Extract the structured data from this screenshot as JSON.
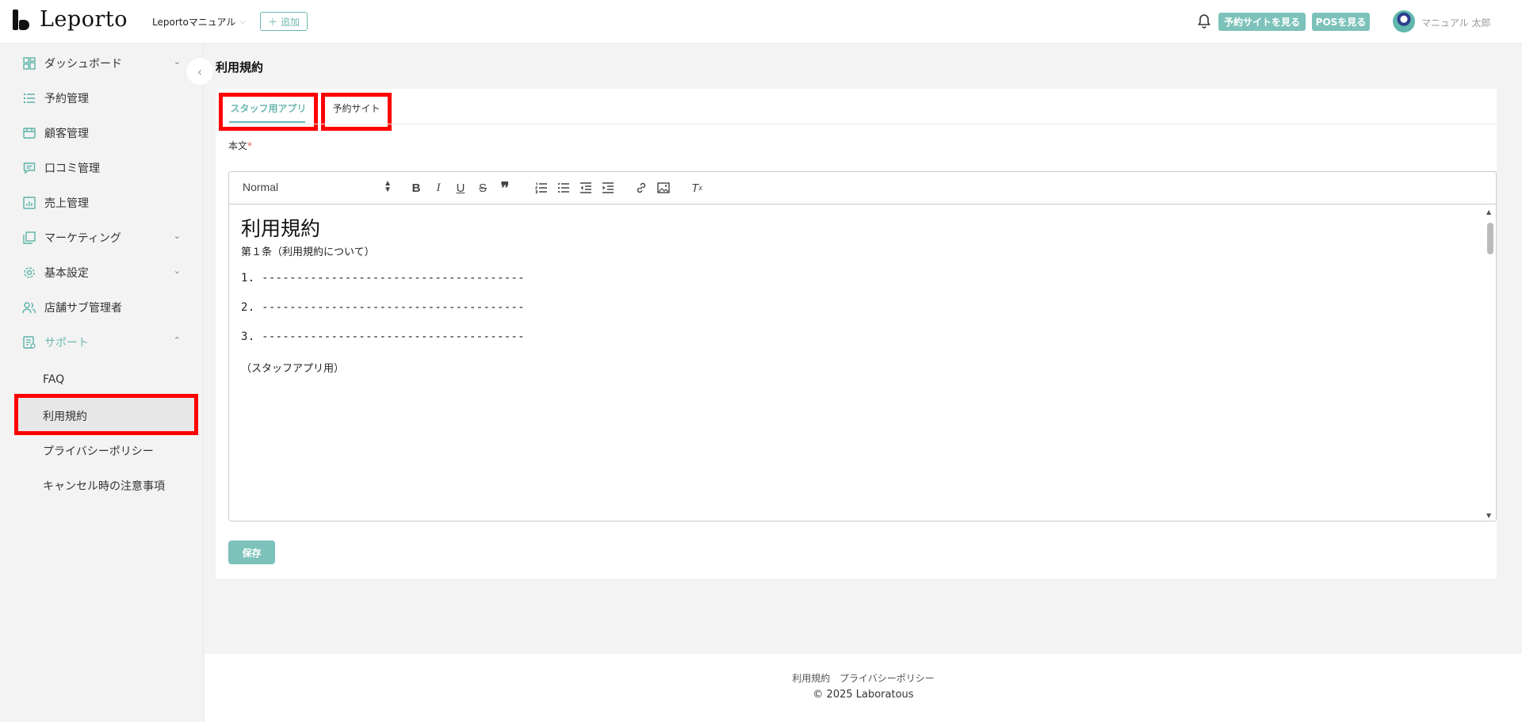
{
  "header": {
    "logo_text": "Leporto",
    "store_name": "Leportoマニュアル",
    "add_label": "追加",
    "view_site_label": "予約サイトを見る",
    "view_pos_label": "POSを見る",
    "user_name": "マニュアル 太郎"
  },
  "sidebar": {
    "items": [
      {
        "label": "ダッシュボード",
        "icon": "dashboard-icon",
        "caret": "⌄"
      },
      {
        "label": "予約管理",
        "icon": "list-icon"
      },
      {
        "label": "顧客管理",
        "icon": "customer-icon"
      },
      {
        "label": "口コミ管理",
        "icon": "review-icon"
      },
      {
        "label": "売上管理",
        "icon": "sales-icon"
      },
      {
        "label": "マーケティング",
        "icon": "marketing-icon",
        "caret": "⌄"
      },
      {
        "label": "基本設定",
        "icon": "gear-icon",
        "caret": "⌄"
      },
      {
        "label": "店舗サブ管理者",
        "icon": "users-icon"
      },
      {
        "label": "サポート",
        "icon": "support-icon",
        "caret": "⌃"
      }
    ],
    "sub_items": [
      "FAQ",
      "利用規約",
      "プライバシーポリシー",
      "キャンセル時の注意事項"
    ]
  },
  "page": {
    "title": "利用規約",
    "tabs": [
      "スタッフ用アプリ",
      "予約サイト"
    ],
    "field_label": "本文",
    "required_mark": "*",
    "save_label": "保存"
  },
  "editor": {
    "format": "Normal",
    "heading": "利用規約",
    "article": "第１条（利用規約について）",
    "items": [
      "1. --------------------------------------",
      "2. --------------------------------------",
      "3. --------------------------------------"
    ],
    "note": "（スタッフアプリ用）"
  },
  "footer": {
    "links": [
      "利用規約",
      "プライバシーポリシー"
    ],
    "copyright": "© 2025 Laboratous"
  },
  "colors": {
    "accent": "#6cb8b0",
    "button": "#7dc2ba",
    "highlight": "#ff0000"
  }
}
